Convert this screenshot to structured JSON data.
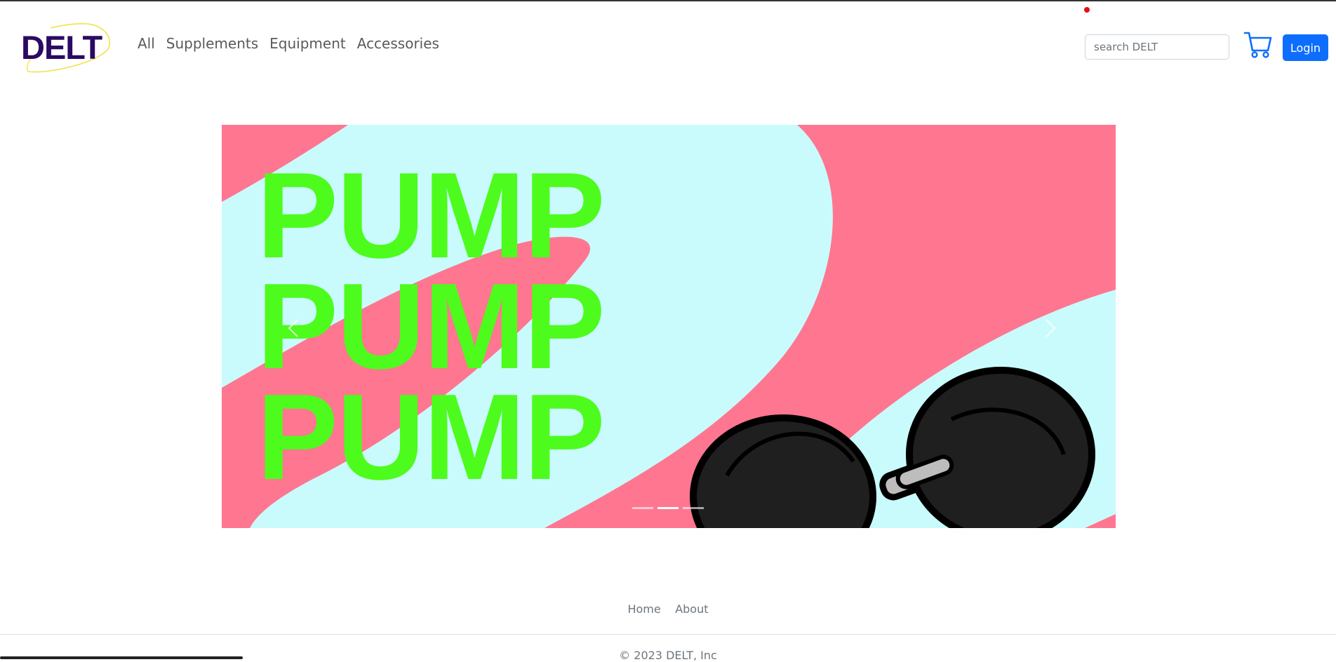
{
  "brand": {
    "logo_text": "DELT",
    "logo_color": "#2a0a63",
    "logo_swoosh_color": "#f2e24a"
  },
  "nav": {
    "items": [
      "All",
      "Supplements",
      "Equipment",
      "Accessories"
    ]
  },
  "search": {
    "placeholder": "search DELT"
  },
  "header": {
    "login_label": "Login",
    "cart_icon": "cart-icon",
    "accent": "#0d6efd"
  },
  "carousel": {
    "slide_text": [
      "PUMP",
      "PUMP",
      "PUMP"
    ],
    "text_color": "#4dfc1c",
    "bg_colors": [
      "#ff7690",
      "#c9fbfc"
    ],
    "prev_icon": "chevron-left-icon",
    "next_icon": "chevron-right-icon",
    "indicator_count": 3,
    "active_slide": 2
  },
  "footer": {
    "links": [
      "Home",
      "About"
    ],
    "copyright": "© 2023 DELT, Inc"
  }
}
